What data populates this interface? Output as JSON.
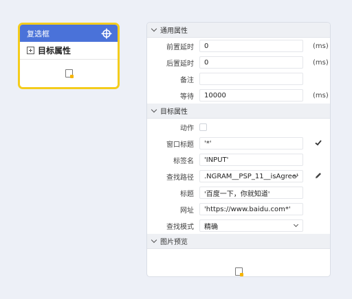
{
  "node": {
    "title": "复选框",
    "prop_label": "目标属性"
  },
  "panel": {
    "sections": {
      "common": "通用属性",
      "target": "目标属性",
      "preview": "图片预览"
    },
    "common": {
      "pre_delay": {
        "label": "前置延时",
        "value": "0",
        "unit": "(ms)"
      },
      "post_delay": {
        "label": "后置延时",
        "value": "0",
        "unit": "(ms)"
      },
      "remark": {
        "label": "备注",
        "value": ""
      },
      "wait": {
        "label": "等待",
        "value": "10000",
        "unit": "(ms)"
      }
    },
    "target": {
      "action": {
        "label": "动作"
      },
      "window_title": {
        "label": "窗口标题",
        "value": "'*'"
      },
      "tag_name": {
        "label": "标签名",
        "value": "'INPUT'"
      },
      "find_path": {
        "label": "查找路径",
        "value": ".NGRAM__PSP_11__isAgree'"
      },
      "title": {
        "label": "标题",
        "value": "'百度一下，你就知道'"
      },
      "url": {
        "label": "网址",
        "value": "'https://www.baidu.com*'"
      },
      "find_mode": {
        "label": "查找模式",
        "value": "精确"
      }
    }
  },
  "colors": {
    "node_header": "#4a72d9",
    "node_border": "#f4cc1c"
  }
}
